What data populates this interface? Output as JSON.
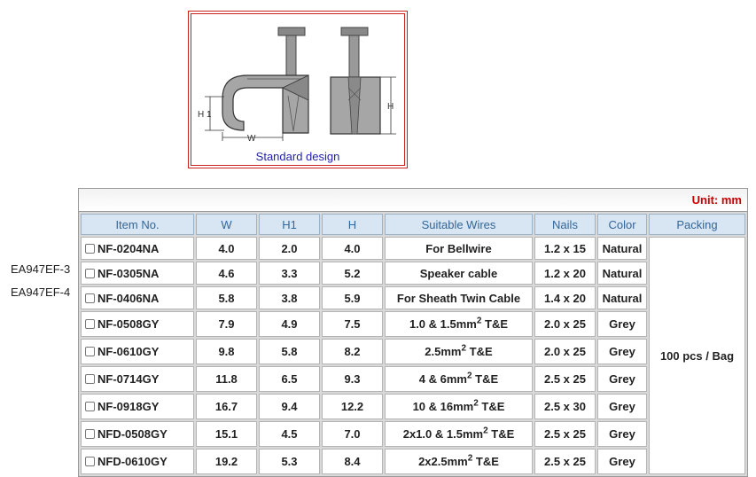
{
  "figure": {
    "caption": "Standard design",
    "dim_h1": "H 1",
    "dim_h": "H",
    "dim_w": "W"
  },
  "side_codes": [
    "EA947EF-3",
    "EA947EF-4"
  ],
  "unit": "Unit: mm",
  "headers": [
    "Item No.",
    "W",
    "H1",
    "H",
    "Suitable Wires",
    "Nails",
    "Color",
    "Packing"
  ],
  "packing": "100 pcs / Bag",
  "rows": [
    {
      "item": "NF-0204NA",
      "w": "4.0",
      "h1": "2.0",
      "h": "4.0",
      "wire": "For Bellwire",
      "sup": "",
      "wire_tail": "",
      "nails": "1.2 x 15",
      "color": "Natural"
    },
    {
      "item": "NF-0305NA",
      "w": "4.6",
      "h1": "3.3",
      "h": "5.2",
      "wire": "Speaker cable",
      "sup": "",
      "wire_tail": "",
      "nails": "1.2 x 20",
      "color": "Natural"
    },
    {
      "item": "NF-0406NA",
      "w": "5.8",
      "h1": "3.8",
      "h": "5.9",
      "wire": "For Sheath Twin Cable",
      "sup": "",
      "wire_tail": "",
      "nails": "1.4 x 20",
      "color": "Natural"
    },
    {
      "item": "NF-0508GY",
      "w": "7.9",
      "h1": "4.9",
      "h": "7.5",
      "wire": "1.0 & 1.5mm",
      "sup": "2",
      "wire_tail": " T&E",
      "nails": "2.0 x 25",
      "color": "Grey"
    },
    {
      "item": "NF-0610GY",
      "w": "9.8",
      "h1": "5.8",
      "h": "8.2",
      "wire": "2.5mm",
      "sup": "2",
      "wire_tail": " T&E",
      "nails": "2.0 x 25",
      "color": "Grey"
    },
    {
      "item": "NF-0714GY",
      "w": "11.8",
      "h1": "6.5",
      "h": "9.3",
      "wire": "4 & 6mm",
      "sup": "2",
      "wire_tail": " T&E",
      "nails": "2.5 x 25",
      "color": "Grey"
    },
    {
      "item": "NF-0918GY",
      "w": "16.7",
      "h1": "9.4",
      "h": "12.2",
      "wire": "10 & 16mm",
      "sup": "2",
      "wire_tail": " T&E",
      "nails": "2.5 x 30",
      "color": "Grey"
    },
    {
      "item": "NFD-0508GY",
      "w": "15.1",
      "h1": "4.5",
      "h": "7.0",
      "wire": "2x1.0 & 1.5mm",
      "sup": "2",
      "wire_tail": " T&E",
      "nails": "2.5 x 25",
      "color": "Grey"
    },
    {
      "item": "NFD-0610GY",
      "w": "19.2",
      "h1": "5.3",
      "h": "8.4",
      "wire": "2x2.5mm",
      "sup": "2",
      "wire_tail": " T&E",
      "nails": "2.5 x 25",
      "color": "Grey"
    }
  ]
}
